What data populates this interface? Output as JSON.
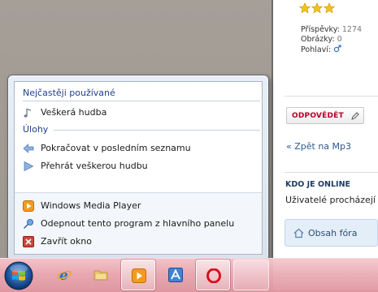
{
  "forum": {
    "stats": {
      "posts_label": "Příspěvky:",
      "posts_value": "1274",
      "images_label": "Obrázky:",
      "images_value": "0",
      "gender_label": "Pohlaví:"
    },
    "reply_button": "ODPOVĚDĚT",
    "back_link": "« Zpět na Mp3",
    "online_title": "KDO JE ONLINE",
    "online_text": "Uživatelé procházejí",
    "forum_index": "Obsah fóra"
  },
  "jumplist": {
    "frequent_heading": "Nejčastěji používané",
    "frequent_items": [
      "Veškerá hudba"
    ],
    "tasks_heading": "Úlohy",
    "task_items": [
      "Pokračovat v posledním seznamu",
      "Přehrát veškerou hudbu"
    ],
    "app_items": [
      "Windows Media Player",
      "Odepnout tento program z hlavního panelu",
      "Zavřít okno"
    ]
  },
  "icons": {
    "music": "music-note-icon",
    "resume": "arrow-left-icon",
    "play": "play-icon",
    "wmp": "windows-media-player-icon",
    "unpin": "unpin-icon",
    "close": "close-window-icon"
  },
  "colors": {
    "heading_blue": "#1e3f8f",
    "reply_red": "#b3002a",
    "taskbar_pink": "#e9a8b1"
  }
}
